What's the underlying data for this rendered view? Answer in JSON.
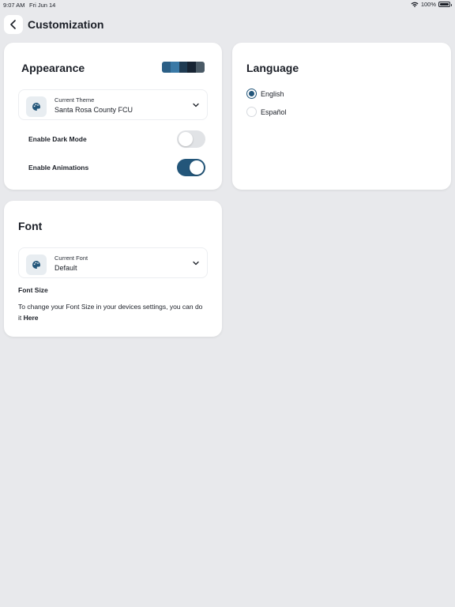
{
  "status_bar": {
    "time": "9:07 AM",
    "date": "Fri Jun 14",
    "battery": "100%"
  },
  "header": {
    "title": "Customization",
    "back_icon": "chevron-left-icon"
  },
  "appearance": {
    "title": "Appearance",
    "swatch_colors": [
      "#2b5f86",
      "#3a79a6",
      "#1f3b52",
      "#172433",
      "#4a5a66"
    ],
    "theme_label": "Current Theme",
    "theme_value": "Santa Rosa County FCU",
    "dark_mode_label": "Enable Dark Mode",
    "dark_mode_on": false,
    "animations_label": "Enable Animations",
    "animations_on": true
  },
  "language": {
    "title": "Language",
    "options": [
      {
        "label": "English",
        "selected": true
      },
      {
        "label": "Español",
        "selected": false
      }
    ]
  },
  "font": {
    "title": "Font",
    "current_label": "Current Font",
    "current_value": "Default",
    "size_title": "Font Size",
    "size_description": "To change your Font Size in your devices settings, you can do it",
    "size_link": "Here"
  },
  "colors": {
    "accent": "#23567a",
    "toggle_off": "#e1e3e6",
    "background": "#e8e9ec"
  }
}
